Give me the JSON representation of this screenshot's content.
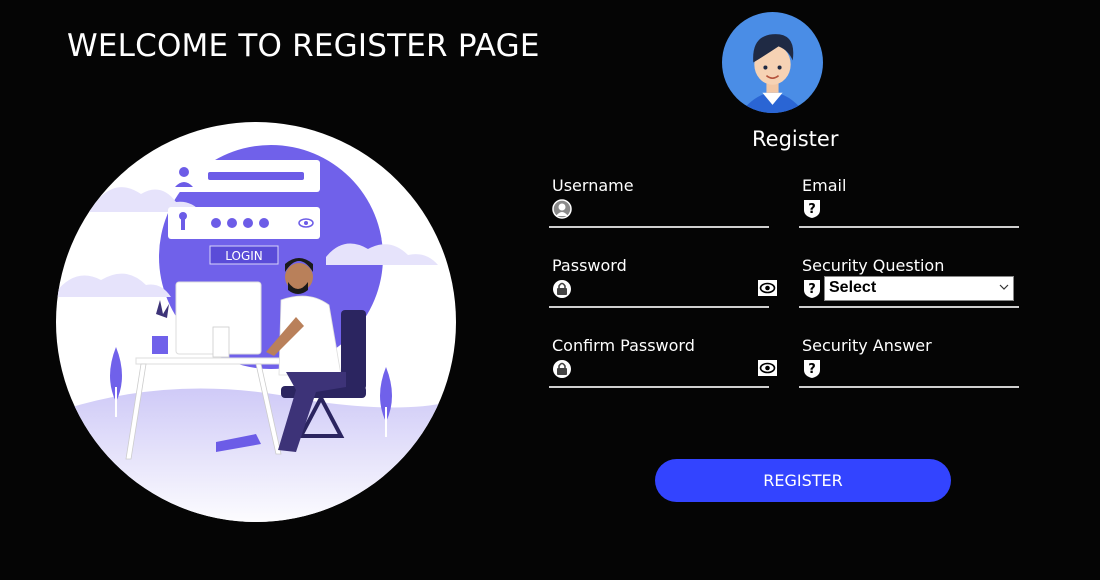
{
  "page": {
    "title": "WELCOME TO REGISTER PAGE"
  },
  "illustration": {
    "login_button_label": "LOGIN"
  },
  "form": {
    "title": "Register",
    "username": {
      "label": "Username",
      "value": "",
      "icon": "user-icon"
    },
    "email": {
      "label": "Email",
      "value": "",
      "icon": "question-shield-icon"
    },
    "password": {
      "label": "Password",
      "value": "",
      "icon": "lock-icon",
      "toggle_icon": "eye-icon"
    },
    "security_question": {
      "label": "Security Question",
      "selected": "Select",
      "icon": "question-shield-icon"
    },
    "confirm_password": {
      "label": "Confirm Password",
      "value": "",
      "icon": "lock-icon",
      "toggle_icon": "eye-icon"
    },
    "security_answer": {
      "label": "Security Answer",
      "value": "",
      "icon": "question-shield-icon"
    },
    "submit_label": "REGISTER"
  },
  "colors": {
    "background": "#050505",
    "accent": "#3344ff",
    "illustration_purple": "#6c5ce7"
  }
}
